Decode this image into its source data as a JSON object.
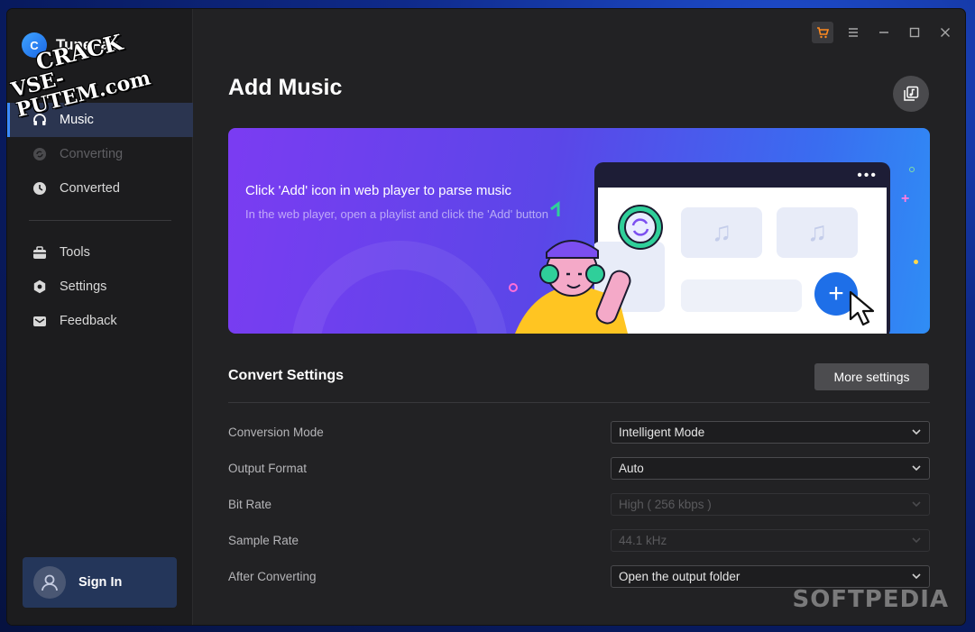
{
  "app": {
    "brand_name": "TuneFab",
    "brand_logo_text": "C"
  },
  "watermarks": {
    "crack_line1": "CRACK",
    "crack_line2": "VSE-PUTEM.com",
    "softpedia": "SOFTPEDIA"
  },
  "sidebar": {
    "items": [
      {
        "label": "Music",
        "icon": "headphones-icon",
        "active": true
      },
      {
        "label": "Converting",
        "icon": "converting-icon",
        "disabled": true
      },
      {
        "label": "Converted",
        "icon": "clock-icon"
      },
      {
        "label": "Tools",
        "icon": "toolbox-icon"
      },
      {
        "label": "Settings",
        "icon": "gear-icon"
      },
      {
        "label": "Feedback",
        "icon": "mail-icon"
      }
    ],
    "signin_label": "Sign In"
  },
  "main": {
    "title": "Add Music",
    "banner": {
      "title": "Click 'Add' icon in web player to parse music",
      "subtitle": "In the web player, open a playlist and click the 'Add' button"
    },
    "convert_settings": {
      "title": "Convert Settings",
      "more_button": "More settings",
      "rows": [
        {
          "label": "Conversion Mode",
          "value": "Intelligent Mode",
          "disabled": false
        },
        {
          "label": "Output Format",
          "value": "Auto",
          "disabled": false
        },
        {
          "label": "Bit Rate",
          "value": "High ( 256 kbps )",
          "disabled": true
        },
        {
          "label": "Sample Rate",
          "value": "44.1 kHz",
          "disabled": true
        },
        {
          "label": "After Converting",
          "value": "Open the output folder",
          "disabled": false
        }
      ]
    }
  },
  "colors": {
    "accent": "#3b8bff",
    "cart": "#ff8a1f",
    "banner_start": "#7b3cf2",
    "banner_end": "#2f8df5"
  }
}
